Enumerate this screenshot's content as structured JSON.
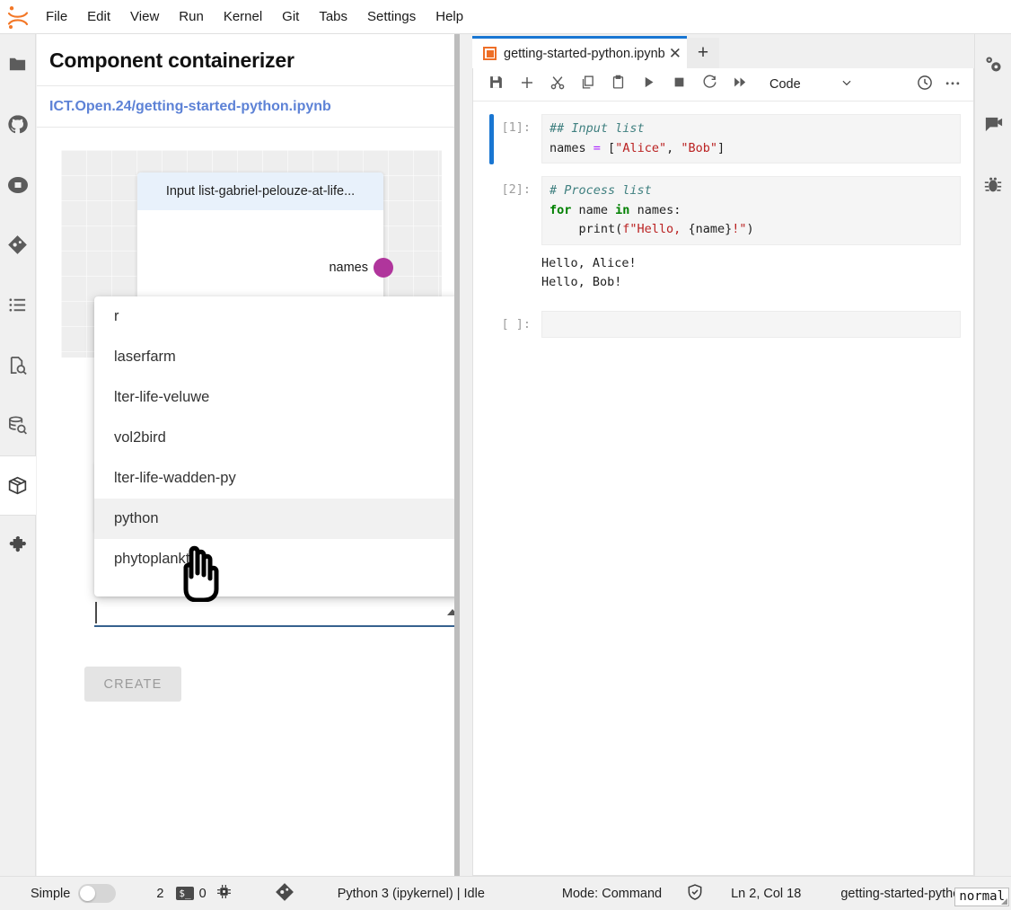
{
  "menubar": {
    "logo_icon": "jupyter-logo-icon",
    "items": [
      "File",
      "Edit",
      "View",
      "Run",
      "Kernel",
      "Git",
      "Tabs",
      "Settings",
      "Help"
    ]
  },
  "left_rail": {
    "items": [
      {
        "icon": "folder-icon",
        "name": "file-browser",
        "active": false
      },
      {
        "icon": "github-icon",
        "name": "github",
        "active": false
      },
      {
        "icon": "stop-circle-icon",
        "name": "running-terminals",
        "active": false
      },
      {
        "icon": "git-icon",
        "name": "git-panel",
        "active": false
      },
      {
        "icon": "list-icon",
        "name": "table-of-contents",
        "active": false
      },
      {
        "icon": "file-search-icon",
        "name": "search-replace",
        "active": false
      },
      {
        "icon": "database-search-icon",
        "name": "data-catalog",
        "active": false
      },
      {
        "icon": "package-icon",
        "name": "component-containerizer",
        "active": true
      },
      {
        "icon": "puzzle-icon",
        "name": "extension-manager",
        "active": false
      }
    ]
  },
  "right_rail": {
    "items": [
      {
        "icon": "gears-icon",
        "name": "property-inspector"
      },
      {
        "icon": "chat-video-icon",
        "name": "chat-panel"
      },
      {
        "icon": "bug-icon",
        "name": "debugger"
      }
    ]
  },
  "containerizer": {
    "title": "Component containerizer",
    "path": "ICT.Open.24/getting-started-python.ipynb",
    "node": {
      "header": "Input list-gabriel-pelouze-at-life...",
      "output_port_label": "names",
      "output_port_color": "#b0359c"
    },
    "select": {
      "value": "",
      "caret_icon": "chevron-up-icon"
    },
    "dropdown": {
      "options": [
        "r",
        "laserfarm",
        "lter-life-veluwe",
        "vol2bird",
        "lter-life-wadden-py",
        "python",
        "phytoplankton"
      ],
      "highlighted": "python"
    },
    "create_button": "CREATE"
  },
  "notebook": {
    "tab": {
      "label": "getting-started-python.ipynb",
      "icon": "notebook-icon",
      "close_icon": "close-icon"
    },
    "add_tab_icon": "plus-icon",
    "toolbar": {
      "buttons": [
        {
          "icon": "save-icon",
          "name": "save-notebook"
        },
        {
          "icon": "plus-icon",
          "name": "insert-cell"
        },
        {
          "icon": "scissors-icon",
          "name": "cut-cells"
        },
        {
          "icon": "copy-icon",
          "name": "copy-cells"
        },
        {
          "icon": "paste-icon",
          "name": "paste-cells"
        },
        {
          "icon": "play-icon",
          "name": "run-cell"
        },
        {
          "icon": "stop-icon",
          "name": "interrupt-kernel"
        },
        {
          "icon": "restart-icon",
          "name": "restart-kernel"
        },
        {
          "icon": "fast-forward-icon",
          "name": "restart-and-run-all"
        }
      ],
      "cell_type": "Code",
      "cell_type_caret": "chevron-down-icon",
      "clock_icon": "clock-icon",
      "overflow_icon": "ellipsis-icon"
    },
    "cells": [
      {
        "prompt": "[1]:",
        "active": true,
        "lines": [
          [
            {
              "t": "# Input list",
              "c": "k-com"
            }
          ],
          [
            {
              "t": "names "
            },
            {
              "t": "=",
              "c": "k-op"
            },
            {
              "t": " ["
            },
            {
              "t": "\"Alice\"",
              "c": "k-str"
            },
            {
              "t": ", "
            },
            {
              "t": "\"Bob\"",
              "c": "k-str"
            },
            {
              "t": "]"
            }
          ]
        ],
        "output": ""
      },
      {
        "prompt": "[2]:",
        "active": false,
        "lines": [
          [
            {
              "t": "# Process list",
              "c": "k-com"
            }
          ],
          [
            {
              "t": "for",
              "c": "k-kw"
            },
            {
              "t": " name "
            },
            {
              "t": "in",
              "c": "k-kw"
            },
            {
              "t": " names:"
            }
          ],
          [
            {
              "t": "    print("
            },
            {
              "t": "f\"Hello, ",
              "c": "k-str"
            },
            {
              "t": "{name}"
            },
            {
              "t": "!\"",
              "c": "k-str"
            },
            {
              "t": ")"
            }
          ]
        ],
        "output": "Hello, Alice!\nHello, Bob!"
      },
      {
        "prompt": "[ ]:",
        "active": false,
        "lines": [],
        "output": ""
      }
    ]
  },
  "statusbar": {
    "simple_label": "Simple",
    "simple_toggle_on": false,
    "kernel_count": "2",
    "terminal_badge": "$_",
    "terminal_count": "0",
    "cpu_icon": "chip-icon",
    "git_icon": "git-icon",
    "kernel_status": "Python 3 (ipykernel) | Idle",
    "mode": "Mode: Command",
    "trust_icon": "shield-check-icon",
    "cursor_position": "Ln 2, Col 18",
    "file_name": "getting-started-python.",
    "overlay_value": "normal"
  }
}
